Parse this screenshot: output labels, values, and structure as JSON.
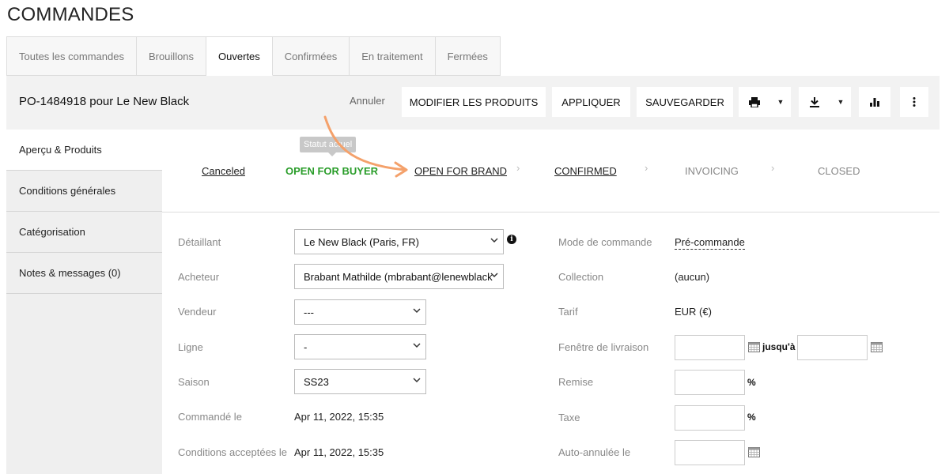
{
  "page": {
    "title": "COMMANDES"
  },
  "tabs": [
    {
      "label": "Toutes les commandes"
    },
    {
      "label": "Brouillons"
    },
    {
      "label": "Ouvertes"
    },
    {
      "label": "Confirmées"
    },
    {
      "label": "En traitement"
    },
    {
      "label": "Fermées"
    }
  ],
  "order": {
    "title": "PO-1484918 pour Le New Black",
    "cancel_label": "Annuler",
    "modify_label": "MODIFIER LES PRODUITS",
    "apply_label": "APPLIQUER",
    "save_label": "SAUVEGARDER",
    "icons": [
      "printer-icon",
      "download-icon",
      "bar-chart-icon",
      "more-vertical-icon"
    ]
  },
  "sidebar": {
    "items": [
      {
        "label": "Aperçu & Produits"
      },
      {
        "label": "Conditions générales"
      },
      {
        "label": "Catégorisation"
      },
      {
        "label": "Notes & messages (0)"
      }
    ]
  },
  "status": {
    "tooltip": "Statut actuel",
    "steps": [
      {
        "label": "Canceled"
      },
      {
        "label": "OPEN FOR BUYER"
      },
      {
        "label": "OPEN FOR BRAND"
      },
      {
        "label": "CONFIRMED"
      },
      {
        "label": "INVOICING"
      },
      {
        "label": "CLOSED"
      }
    ],
    "current_color": "#2a9d2a",
    "annotation_arrow_color": "#f4a16b"
  },
  "form": {
    "left": {
      "retailer_label": "Détaillant",
      "retailer_value": "Le New Black (Paris, FR)",
      "buyer_label": "Acheteur",
      "buyer_value": "Brabant Mathilde (mbrabant@lenewblack",
      "seller_label": "Vendeur",
      "seller_value": "---",
      "line_label": "Ligne",
      "line_value": "-",
      "season_label": "Saison",
      "season_value": "SS23",
      "ordered_label": "Commandé le",
      "ordered_value": "Apr 11, 2022, 15:35",
      "terms_label": "Conditions acceptées le",
      "terms_value": "Apr 11, 2022, 15:35"
    },
    "right": {
      "order_mode_label": "Mode de commande",
      "order_mode_value": "Pré-commande",
      "collection_label": "Collection",
      "collection_value": "(aucun)",
      "tariff_label": "Tarif",
      "tariff_value": "EUR (€)",
      "delivery_label": "Fenêtre de livraison",
      "until_label": "jusqu'à",
      "discount_label": "Remise",
      "percent_sign": "%",
      "tax_label": "Taxe",
      "auto_cancel_label": "Auto-annulée le"
    }
  }
}
